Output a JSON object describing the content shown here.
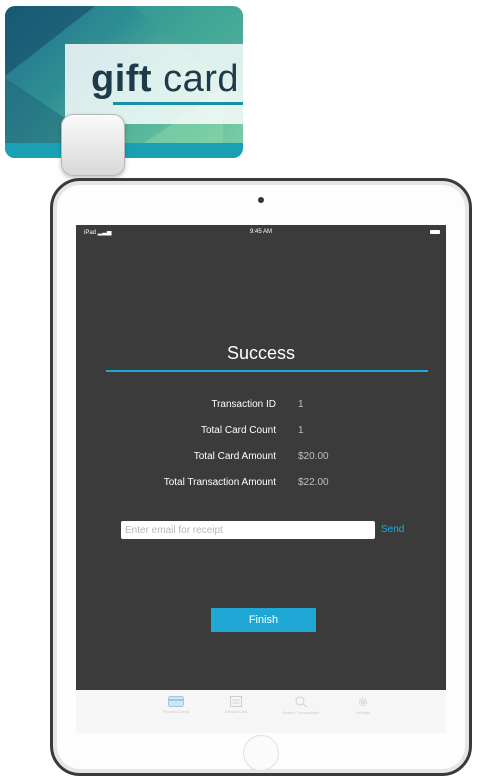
{
  "gift_card": {
    "logo_gift": "gift",
    "logo_card": "card"
  },
  "status_bar": {
    "device": "iPad",
    "time": "9:45 AM"
  },
  "screen": {
    "title": "Success",
    "rows": [
      {
        "label": "Transaction ID",
        "value": "1"
      },
      {
        "label": "Total Card Count",
        "value": "1"
      },
      {
        "label": "Total Card Amount",
        "value": "$20.00"
      },
      {
        "label": "Total Transaction Amount",
        "value": "$22.00"
      }
    ],
    "email_placeholder": "Enter email for receipt",
    "send_label": "Send",
    "finish_label": "Finish"
  },
  "tabs": [
    {
      "label": "Process Cards",
      "icon": "card-icon"
    },
    {
      "label": "Reload Card",
      "icon": "receipt-icon"
    },
    {
      "label": "Search Transactions",
      "icon": "search-icon"
    },
    {
      "label": "Settings",
      "icon": "gear-icon"
    }
  ],
  "colors": {
    "accent": "#1fa8d6",
    "screen_bg": "#3b3b3b",
    "card_band": "#1aa0b5"
  }
}
